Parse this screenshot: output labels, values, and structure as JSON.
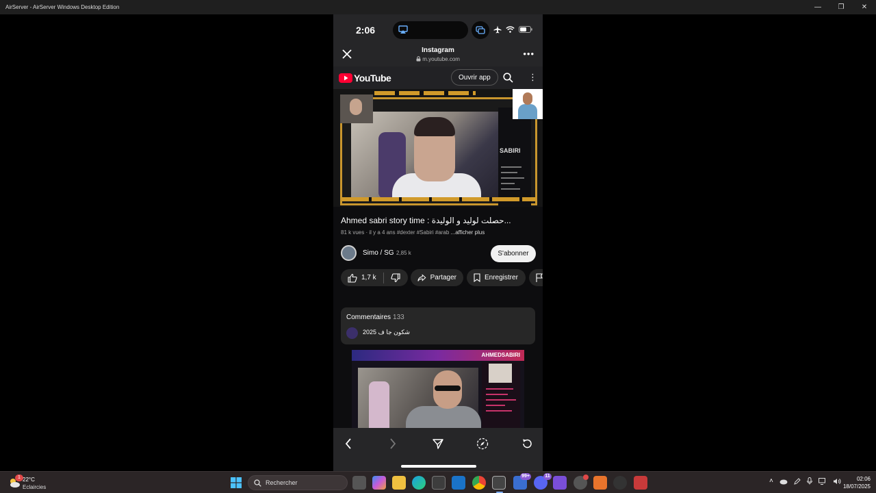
{
  "window": {
    "title": "AirServer - AirServer Windows Desktop Edition",
    "controls": {
      "minimize": "—",
      "restore": "❐",
      "close": "✕"
    }
  },
  "phone": {
    "status": {
      "time": "2:06"
    },
    "ig_header": {
      "app_name": "Instagram",
      "url": "m.youtube.com",
      "more": "•••"
    },
    "yt_bar": {
      "logo_text": "YouTube",
      "open_app": "Ouvrir app"
    },
    "video": {
      "title": "Ahmed sabri story time : حصلت لوليد و الوليدة...",
      "stats": "81 k vues · il y a 4 ans   #dexter #Sabiri #arab",
      "show_more": "...afficher plus",
      "side_badge": "SABIRI"
    },
    "channel": {
      "name": "Simo / SG",
      "subs": "2,85 k",
      "subscribe": "S'abonner"
    },
    "actions": {
      "likes": "1,7 k",
      "share": "Partager",
      "save": "Enregistrer"
    },
    "comments": {
      "label": "Commentaires",
      "count": "133",
      "top_comment": "شكون جا ف 2025"
    },
    "next_video": {
      "banner": "AHMEDSABIRI"
    }
  },
  "taskbar": {
    "weather": {
      "temp": "22°C",
      "desc": "Eclaircies",
      "badge": "1"
    },
    "search_placeholder": "Rechercher",
    "badges": {
      "notes": "99+",
      "discord": "11"
    },
    "clock": {
      "time": "02:06",
      "date": "18/07/2025"
    }
  },
  "colors": {
    "yt_red": "#ff0033",
    "accent_gold": "#d19a2a",
    "subscribe_bg": "#f1f1f1"
  }
}
